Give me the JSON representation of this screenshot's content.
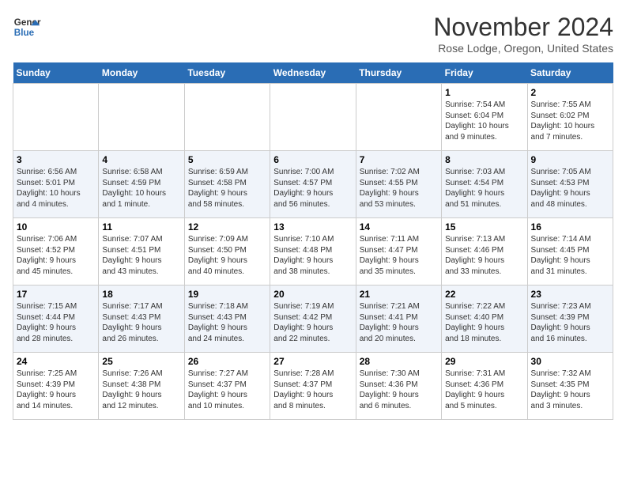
{
  "header": {
    "logo_line1": "General",
    "logo_line2": "Blue",
    "month": "November 2024",
    "location": "Rose Lodge, Oregon, United States"
  },
  "weekdays": [
    "Sunday",
    "Monday",
    "Tuesday",
    "Wednesday",
    "Thursday",
    "Friday",
    "Saturday"
  ],
  "weeks": [
    [
      {
        "day": "",
        "info": ""
      },
      {
        "day": "",
        "info": ""
      },
      {
        "day": "",
        "info": ""
      },
      {
        "day": "",
        "info": ""
      },
      {
        "day": "",
        "info": ""
      },
      {
        "day": "1",
        "info": "Sunrise: 7:54 AM\nSunset: 6:04 PM\nDaylight: 10 hours\nand 9 minutes."
      },
      {
        "day": "2",
        "info": "Sunrise: 7:55 AM\nSunset: 6:02 PM\nDaylight: 10 hours\nand 7 minutes."
      }
    ],
    [
      {
        "day": "3",
        "info": "Sunrise: 6:56 AM\nSunset: 5:01 PM\nDaylight: 10 hours\nand 4 minutes."
      },
      {
        "day": "4",
        "info": "Sunrise: 6:58 AM\nSunset: 4:59 PM\nDaylight: 10 hours\nand 1 minute."
      },
      {
        "day": "5",
        "info": "Sunrise: 6:59 AM\nSunset: 4:58 PM\nDaylight: 9 hours\nand 58 minutes."
      },
      {
        "day": "6",
        "info": "Sunrise: 7:00 AM\nSunset: 4:57 PM\nDaylight: 9 hours\nand 56 minutes."
      },
      {
        "day": "7",
        "info": "Sunrise: 7:02 AM\nSunset: 4:55 PM\nDaylight: 9 hours\nand 53 minutes."
      },
      {
        "day": "8",
        "info": "Sunrise: 7:03 AM\nSunset: 4:54 PM\nDaylight: 9 hours\nand 51 minutes."
      },
      {
        "day": "9",
        "info": "Sunrise: 7:05 AM\nSunset: 4:53 PM\nDaylight: 9 hours\nand 48 minutes."
      }
    ],
    [
      {
        "day": "10",
        "info": "Sunrise: 7:06 AM\nSunset: 4:52 PM\nDaylight: 9 hours\nand 45 minutes."
      },
      {
        "day": "11",
        "info": "Sunrise: 7:07 AM\nSunset: 4:51 PM\nDaylight: 9 hours\nand 43 minutes."
      },
      {
        "day": "12",
        "info": "Sunrise: 7:09 AM\nSunset: 4:50 PM\nDaylight: 9 hours\nand 40 minutes."
      },
      {
        "day": "13",
        "info": "Sunrise: 7:10 AM\nSunset: 4:48 PM\nDaylight: 9 hours\nand 38 minutes."
      },
      {
        "day": "14",
        "info": "Sunrise: 7:11 AM\nSunset: 4:47 PM\nDaylight: 9 hours\nand 35 minutes."
      },
      {
        "day": "15",
        "info": "Sunrise: 7:13 AM\nSunset: 4:46 PM\nDaylight: 9 hours\nand 33 minutes."
      },
      {
        "day": "16",
        "info": "Sunrise: 7:14 AM\nSunset: 4:45 PM\nDaylight: 9 hours\nand 31 minutes."
      }
    ],
    [
      {
        "day": "17",
        "info": "Sunrise: 7:15 AM\nSunset: 4:44 PM\nDaylight: 9 hours\nand 28 minutes."
      },
      {
        "day": "18",
        "info": "Sunrise: 7:17 AM\nSunset: 4:43 PM\nDaylight: 9 hours\nand 26 minutes."
      },
      {
        "day": "19",
        "info": "Sunrise: 7:18 AM\nSunset: 4:43 PM\nDaylight: 9 hours\nand 24 minutes."
      },
      {
        "day": "20",
        "info": "Sunrise: 7:19 AM\nSunset: 4:42 PM\nDaylight: 9 hours\nand 22 minutes."
      },
      {
        "day": "21",
        "info": "Sunrise: 7:21 AM\nSunset: 4:41 PM\nDaylight: 9 hours\nand 20 minutes."
      },
      {
        "day": "22",
        "info": "Sunrise: 7:22 AM\nSunset: 4:40 PM\nDaylight: 9 hours\nand 18 minutes."
      },
      {
        "day": "23",
        "info": "Sunrise: 7:23 AM\nSunset: 4:39 PM\nDaylight: 9 hours\nand 16 minutes."
      }
    ],
    [
      {
        "day": "24",
        "info": "Sunrise: 7:25 AM\nSunset: 4:39 PM\nDaylight: 9 hours\nand 14 minutes."
      },
      {
        "day": "25",
        "info": "Sunrise: 7:26 AM\nSunset: 4:38 PM\nDaylight: 9 hours\nand 12 minutes."
      },
      {
        "day": "26",
        "info": "Sunrise: 7:27 AM\nSunset: 4:37 PM\nDaylight: 9 hours\nand 10 minutes."
      },
      {
        "day": "27",
        "info": "Sunrise: 7:28 AM\nSunset: 4:37 PM\nDaylight: 9 hours\nand 8 minutes."
      },
      {
        "day": "28",
        "info": "Sunrise: 7:30 AM\nSunset: 4:36 PM\nDaylight: 9 hours\nand 6 minutes."
      },
      {
        "day": "29",
        "info": "Sunrise: 7:31 AM\nSunset: 4:36 PM\nDaylight: 9 hours\nand 5 minutes."
      },
      {
        "day": "30",
        "info": "Sunrise: 7:32 AM\nSunset: 4:35 PM\nDaylight: 9 hours\nand 3 minutes."
      }
    ]
  ]
}
